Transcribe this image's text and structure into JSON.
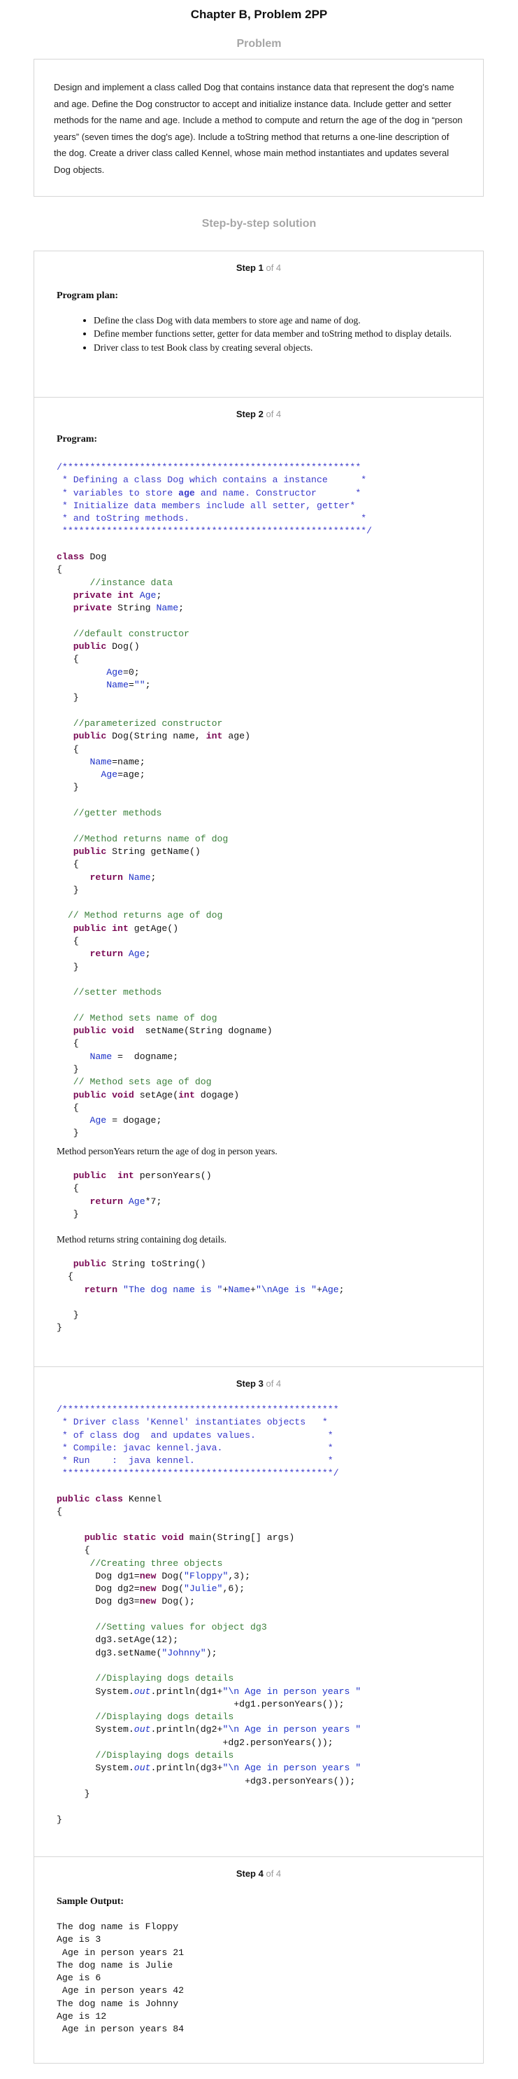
{
  "header": {
    "title": "Chapter B, Problem 2PP"
  },
  "problem": {
    "label": "Problem",
    "text": "Design and implement a class called Dog that contains instance data that represent the dog's name and age. Define the Dog constructor to accept and initialize instance data. Include getter and setter methods for the name and age. Include a method to compute and return the age of the dog in “person years” (seven times the dog's age). Include a toString method that returns a one-line description of the dog. Create a driver class called Kennel, whose main method instantiates and updates several Dog objects."
  },
  "solution": {
    "label": "Step-by-step solution",
    "steps": [
      {
        "title": "Step 1",
        "of": "of 4",
        "heading": "Program plan:",
        "bullets": [
          "Define the class Dog with data members to store age and name of dog.",
          "Define member functions setter, getter for data member and toString method to display details.",
          "Driver class to test Book class by creating several objects."
        ]
      },
      {
        "title": "Step 2",
        "of": "of 4",
        "heading": "Program:",
        "prose": [
          "Method personYears return the age of dog in person years.",
          "Method returns string containing dog details."
        ]
      },
      {
        "title": "Step 3",
        "of": "of 4"
      },
      {
        "title": "Step 4",
        "of": "of 4",
        "heading": "Sample Output:",
        "output": "The dog name is Floppy\nAge is 3\n Age in person years 21\nThe dog name is Julie\nAge is 6\n Age in person years 42\nThe dog name is Johnny\nAge is 12\n Age in person years 84"
      }
    ]
  }
}
